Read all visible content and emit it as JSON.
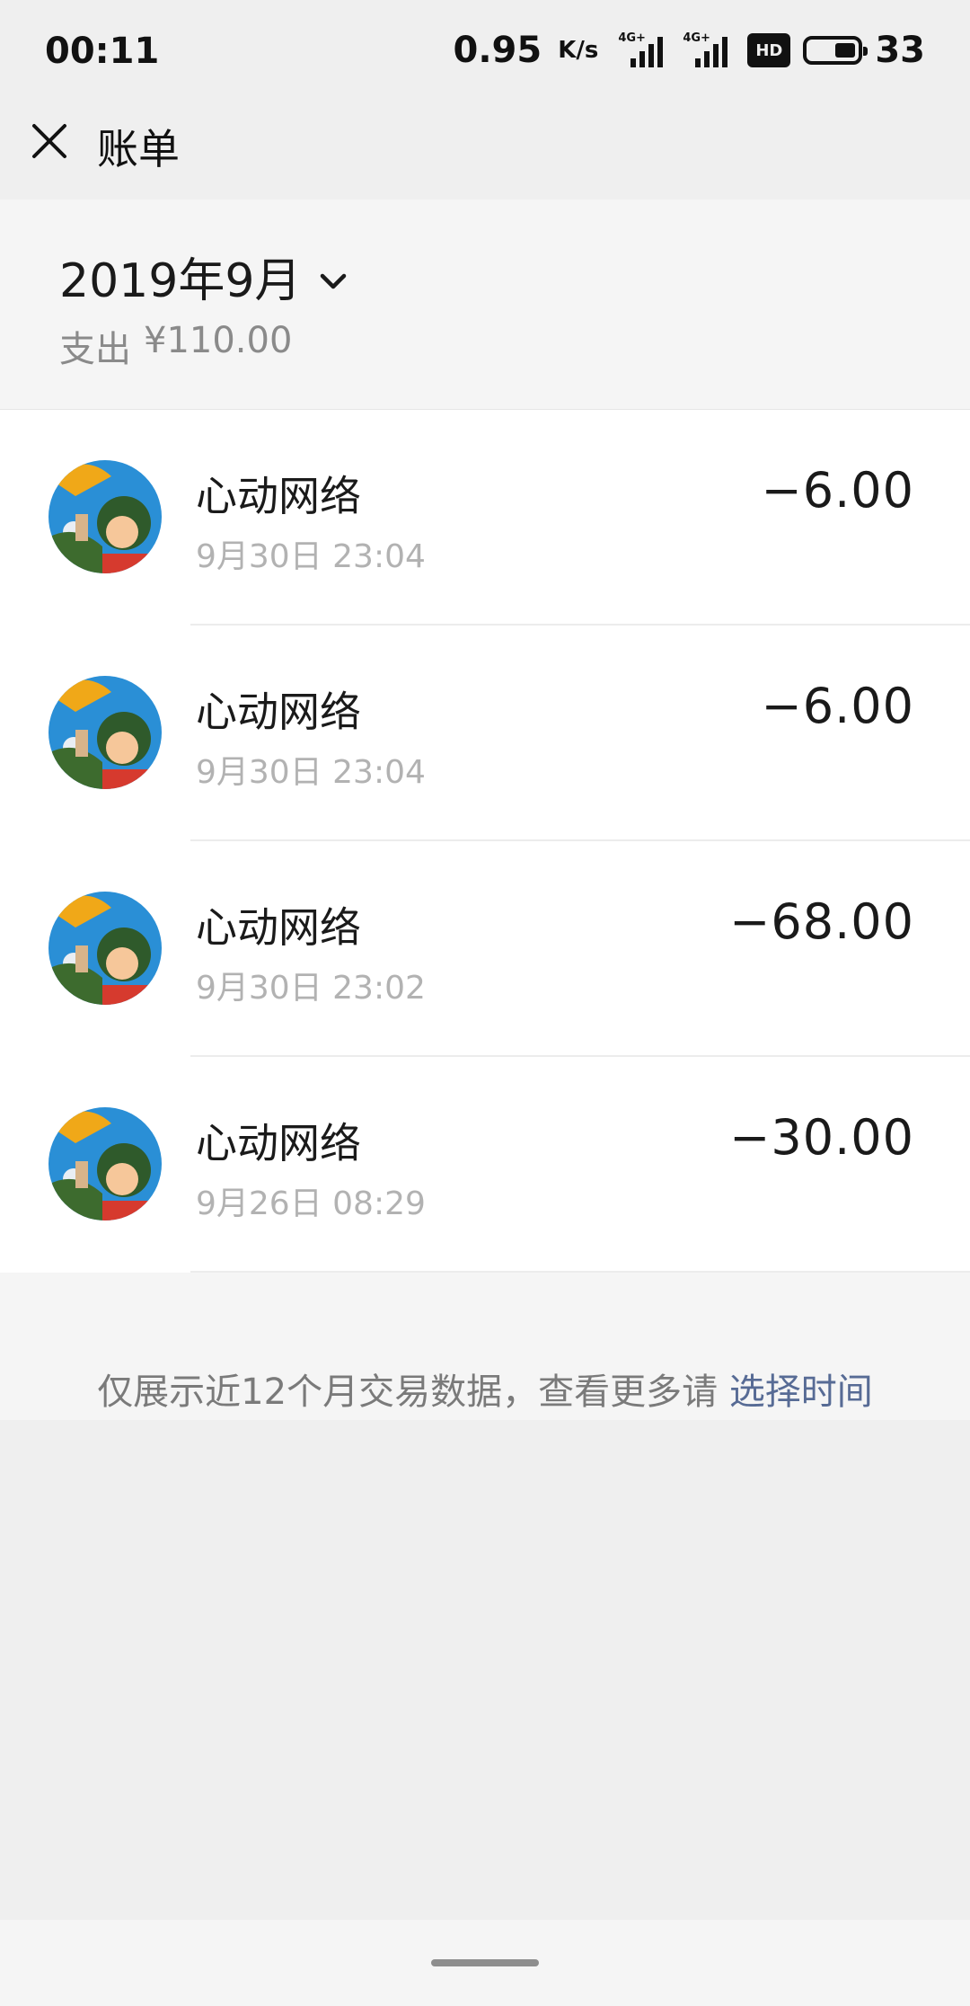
{
  "status_bar": {
    "time": "00:11",
    "network_speed": "0.95",
    "network_speed_unit": "K/s",
    "signal_tags": [
      "4G+",
      "4G+"
    ],
    "hd_label": "HD",
    "battery_level": "33"
  },
  "navbar": {
    "close_icon": "close-icon",
    "title": "账单"
  },
  "month_header": {
    "month": "2019年9月",
    "summary_label": "支出",
    "summary_value": "¥110.00"
  },
  "transactions": [
    {
      "merchant": "心动网络",
      "time": "9月30日 23:04",
      "amount": "−6.00"
    },
    {
      "merchant": "心动网络",
      "time": "9月30日 23:04",
      "amount": "−6.00"
    },
    {
      "merchant": "心动网络",
      "time": "9月30日 23:02",
      "amount": "−68.00"
    },
    {
      "merchant": "心动网络",
      "time": "9月26日 08:29",
      "amount": "−30.00"
    }
  ],
  "footer": {
    "note": "仅展示近12个月交易数据，查看更多请",
    "link": "选择时间"
  },
  "colors": {
    "link": "#576b95",
    "background": "#efefef",
    "card": "#ffffff"
  }
}
